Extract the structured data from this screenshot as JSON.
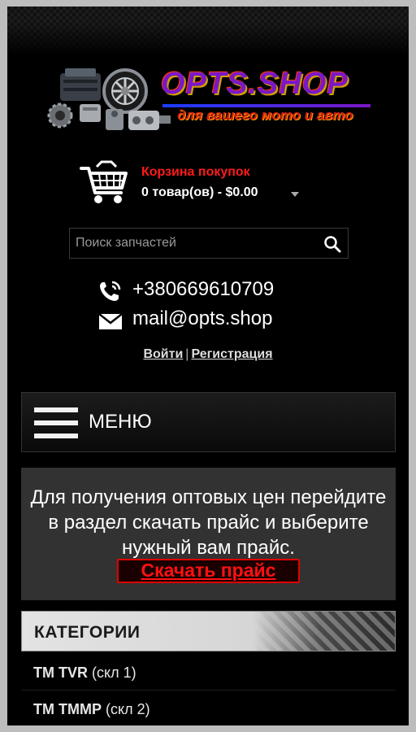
{
  "header": {
    "logo_title": "OPTS.SHOP",
    "logo_subtitle": "для вашего мото и авто"
  },
  "cart": {
    "title": "Корзина покупок",
    "total": "0 товар(ов) - $0.00"
  },
  "search": {
    "placeholder": "Поиск запчастей"
  },
  "contacts": {
    "phone": "+380669610709",
    "email": "mail@opts.shop"
  },
  "auth": {
    "login": "Войти",
    "separator": "|",
    "register": "Регистрация"
  },
  "menu": {
    "label": "МЕНЮ"
  },
  "notice": {
    "text": "Для получения оптовых цен перейдите в раздел скачать прайс и выберите нужный вам прайс.",
    "button": "Скачать прайс"
  },
  "categories": {
    "title": "КАТЕГОРИИ",
    "items": [
      {
        "name": "TM TVR",
        "note": "(скл 1)"
      },
      {
        "name": "TM TMMP",
        "note": "(скл 2)"
      }
    ]
  },
  "colors": {
    "background": "#000000",
    "accent_red": "#ff1a1a",
    "notice_bg": "#323232"
  }
}
